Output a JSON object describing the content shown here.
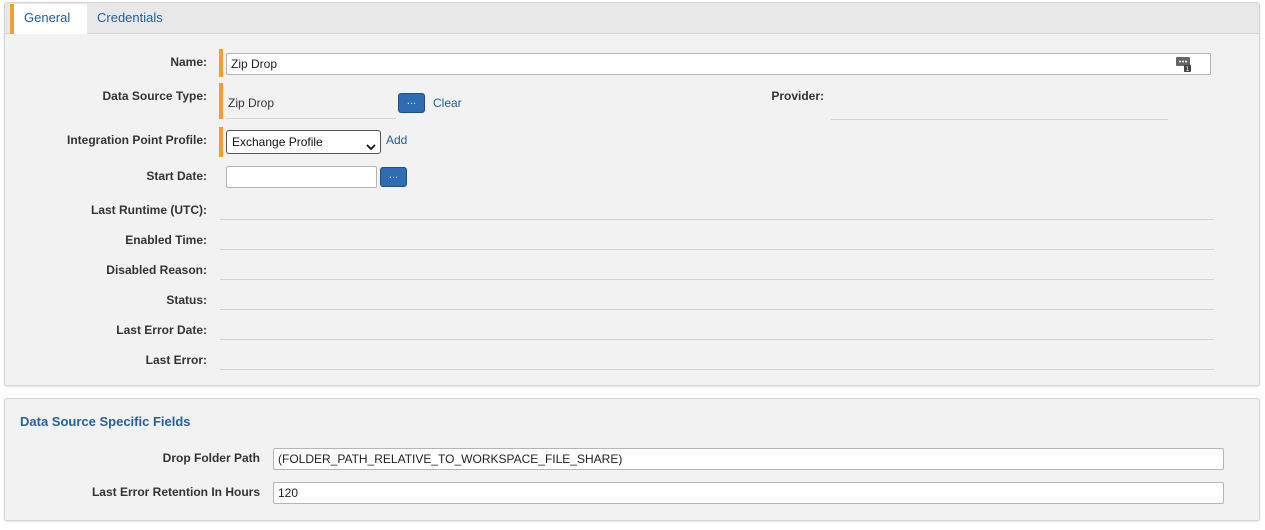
{
  "tabs": [
    {
      "label": "General",
      "active": true
    },
    {
      "label": "Credentials",
      "active": false
    }
  ],
  "general": {
    "name": {
      "label": "Name:",
      "value": "Zip Drop"
    },
    "data_source_type": {
      "label": "Data Source Type:",
      "value": "Zip Drop",
      "browse_label": "...",
      "clear_label": "Clear"
    },
    "provider": {
      "label": "Provider:",
      "value": ""
    },
    "integration_point_profile": {
      "label": "Integration Point Profile:",
      "selected": "Exchange Profile",
      "add_label": "Add"
    },
    "start_date": {
      "label": "Start Date:",
      "value": "",
      "browse_label": "..."
    },
    "last_runtime": {
      "label": "Last Runtime (UTC):",
      "value": ""
    },
    "enabled_time": {
      "label": "Enabled Time:",
      "value": ""
    },
    "disabled_reason": {
      "label": "Disabled Reason:",
      "value": ""
    },
    "status": {
      "label": "Status:",
      "value": ""
    },
    "last_error_date": {
      "label": "Last Error Date:",
      "value": ""
    },
    "last_error": {
      "label": "Last Error:",
      "value": ""
    }
  },
  "data_source_specific": {
    "title": "Data Source Specific Fields",
    "drop_folder_path": {
      "label": "Drop Folder Path",
      "value": "(FOLDER_PATH_RELATIVE_TO_WORKSPACE_FILE_SHARE)"
    },
    "last_error_retention": {
      "label": "Last Error Retention In Hours",
      "value": "120"
    }
  },
  "colors": {
    "accent": "#f0a030",
    "link": "#1f5c99",
    "button": "#2f6cb3",
    "panel_bg": "#f2f2f2"
  },
  "icons": {
    "name_field_icon": "text-field-icon",
    "select_arrow": "chevron-down-icon"
  }
}
